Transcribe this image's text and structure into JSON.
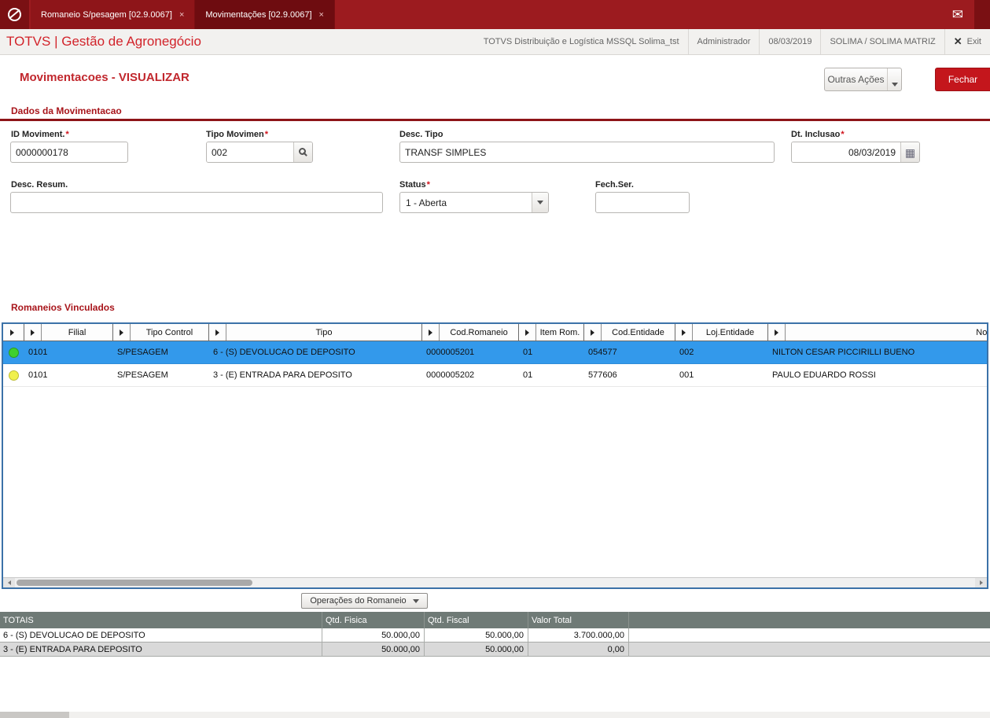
{
  "colors": {
    "topbar": "#9C1B1F",
    "active_tab": "#6E0C10",
    "brand_red": "#D2232A",
    "title_red": "#C1272D",
    "fechar_red": "#C4161C",
    "selected_row_blue": "#3399EB",
    "status_green": "#3FD02F",
    "status_yellow": "#F0F04C",
    "totals_header_gray": "#6F7A76"
  },
  "topbar": {
    "close_icon": "×",
    "tabs": [
      {
        "label": "Romaneio S/pesagem [02.9.0067]"
      },
      {
        "label": "Movimentações [02.9.0067]"
      }
    ],
    "icons": {
      "logo": "no-entry-circle",
      "mail": "✉"
    }
  },
  "header": {
    "brand": "TOTVS | Gestão de Agronegócio",
    "environment": "TOTVS Distribuição e Logística MSSQL Solima_tst",
    "user": "Administrador",
    "date": "08/03/2019",
    "company": "SOLIMA / SOLIMA MATRIZ",
    "exit": {
      "icon": "✕",
      "label": "Exit"
    }
  },
  "page": {
    "title": "Movimentacoes - VISUALIZAR",
    "outras_acoes_label": "Outras Ações",
    "fechar_label": "Fechar"
  },
  "form": {
    "section_title": "Dados da Movimentacao",
    "required_mark": "*",
    "id_moviment": {
      "label": "ID Moviment.",
      "value": "0000000178"
    },
    "tipo_movimen": {
      "label": "Tipo Movimen",
      "value": "002"
    },
    "desc_tipo": {
      "label": "Desc. Tipo",
      "value": "TRANSF SIMPLES"
    },
    "dt_inclusao": {
      "label": "Dt. Inclusao",
      "value": "08/03/2019"
    },
    "desc_resum": {
      "label": "Desc. Resum.",
      "value": ""
    },
    "status": {
      "label": "Status",
      "value": "1 - Aberta"
    },
    "fech_ser": {
      "label": "Fech.Ser.",
      "value": ""
    },
    "icons": {
      "calendar": "▦"
    }
  },
  "grid": {
    "section_title": "Romaneios Vinculados",
    "columns": [
      "Filial",
      "Tipo Control",
      "Tipo",
      "Cod.Romaneio",
      "Item Rom.",
      "Cod.Entidade",
      "Loj.Entidade",
      "Nom.Entida"
    ],
    "rows": [
      {
        "status_color": "green",
        "filial": "0101",
        "tipo_control": "S/PESAGEM",
        "tipo": "6 - (S) DEVOLUCAO DE DEPOSITO",
        "cod_romaneio": "0000005201",
        "item_rom": "01",
        "cod_entidade": "054577",
        "loj_entidade": "002",
        "nom_entidade": "NILTON CESAR PICCIRILLI BUENO"
      },
      {
        "status_color": "yellow",
        "filial": "0101",
        "tipo_control": "S/PESAGEM",
        "tipo": "3 - (E) ENTRADA PARA DEPOSITO",
        "cod_romaneio": "0000005202",
        "item_rom": "01",
        "cod_entidade": "577606",
        "loj_entidade": "001",
        "nom_entidade": "PAULO EDUARDO ROSSI"
      }
    ],
    "operations_button_label": "Operações do Romaneio"
  },
  "totals": {
    "headers": [
      "TOTAIS",
      "Qtd. Fisica",
      "Qtd. Fiscal",
      "Valor Total"
    ],
    "rows": [
      {
        "label": "6 - (S) DEVOLUCAO DE DEPOSITO",
        "qtd_fisica": "50.000,00",
        "qtd_fiscal": "50.000,00",
        "valor_total": "3.700.000,00"
      },
      {
        "label": "3 - (E) ENTRADA PARA DEPOSITO",
        "qtd_fisica": "50.000,00",
        "qtd_fiscal": "50.000,00",
        "valor_total": "0,00"
      }
    ]
  }
}
